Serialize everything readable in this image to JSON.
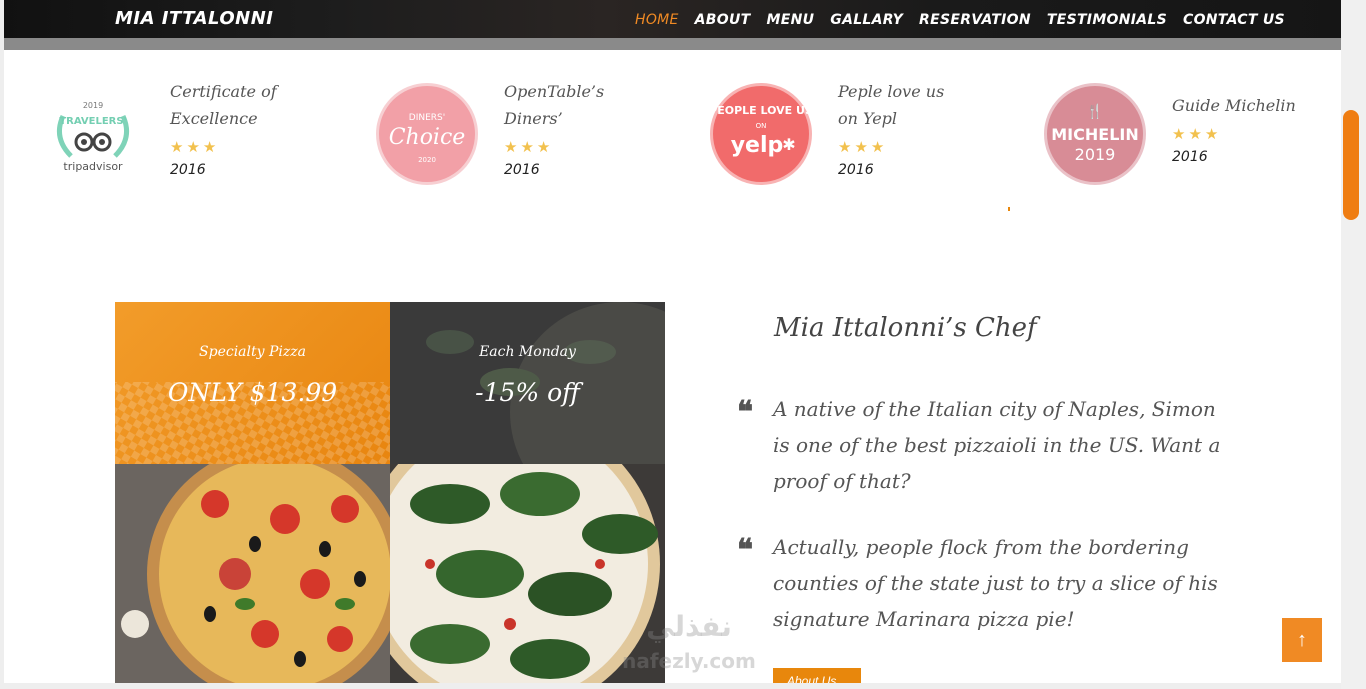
{
  "header": {
    "logo": "MIA ITTALONNI",
    "nav": [
      {
        "label": "HOME",
        "active": true
      },
      {
        "label": "ABOUT",
        "active": false
      },
      {
        "label": "MENU",
        "active": false
      },
      {
        "label": "GALLARY",
        "active": false
      },
      {
        "label": "RESERVATION",
        "active": false
      },
      {
        "label": "TESTIMONIALS",
        "active": false
      },
      {
        "label": "CONTACT US",
        "active": false
      }
    ]
  },
  "awards": [
    {
      "title": "Certificate of Excellence",
      "stars": "★★★",
      "year": "2016",
      "badge_icon": "tripadvisor-badge-icon",
      "badge_text": {
        "top": "2019",
        "mid": "TRAVELERS' CHOICE",
        "brand": "tripadvisor"
      }
    },
    {
      "title": "OpenTable’s Diners’",
      "stars": "★★★",
      "year": "2016",
      "badge_icon": "diners-choice-badge-icon",
      "badge_text": {
        "top": "DINERS'",
        "mid": "Choice",
        "brand": "2020"
      }
    },
    {
      "title": "Peple love us on Yepl",
      "stars": "★★★",
      "year": "2016",
      "badge_icon": "yelp-badge-icon",
      "badge_text": {
        "top": "PEOPLE LOVE US",
        "mid": "ON",
        "brand": "yelp"
      }
    },
    {
      "title": "Guide Michelin",
      "stars": "★★★",
      "year": "2016",
      "badge_icon": "michelin-badge-icon",
      "badge_text": {
        "top": "MICHELIN",
        "mid": "2019",
        "brand": ""
      }
    }
  ],
  "promos": [
    {
      "label": "Specialty Pizza",
      "price": "ONLY $13.99"
    },
    {
      "label": "Each Monday",
      "price": "-15% off"
    }
  ],
  "chef": {
    "title": "Mia Ittalonni’s Chef",
    "quotes": [
      "A native of the Italian city of Naples, Simon is one of the best pizzaioli in the US. Want a proof of that?",
      "Actually, people flock from the bordering counties of the state just to try a slice of his signature Marinara pizza pie!"
    ],
    "button": "About Us"
  },
  "to_top_icon": "arrow-up-icon",
  "watermark": {
    "line1": "نفذلي",
    "line2": "nafezly.com"
  },
  "colors": {
    "accent": "#f08a24",
    "button": "#e8870c",
    "star": "#f2c14e"
  }
}
